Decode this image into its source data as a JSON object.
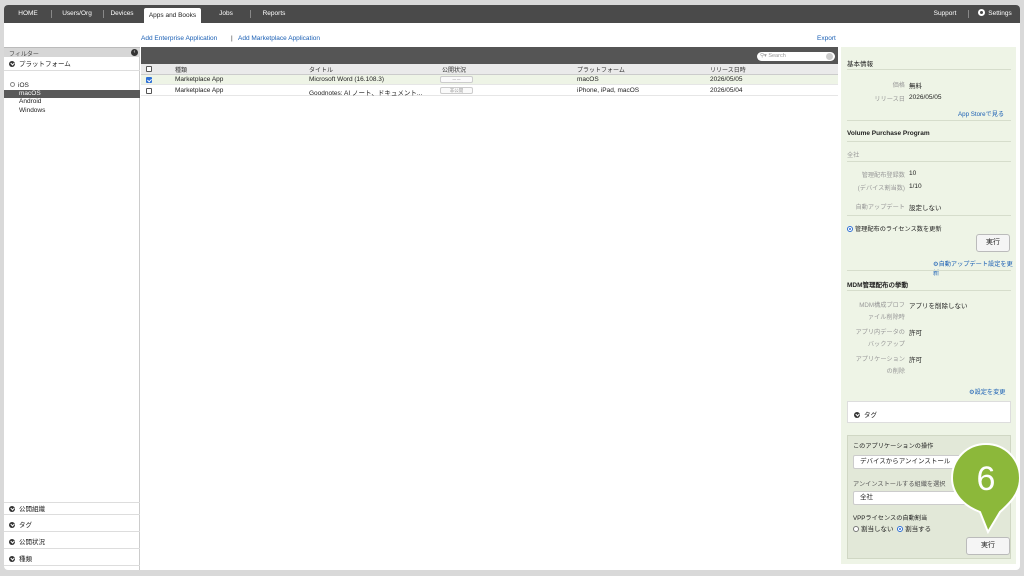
{
  "nav": {
    "items": [
      "HOME",
      "Users/Org",
      "Devices",
      "Apps and Books",
      "Jobs",
      "Reports"
    ],
    "active": "Apps and Books",
    "support": "Support",
    "settings": "Settings"
  },
  "links": {
    "add_enterprise": "Add Enterprise Application",
    "separator": "|",
    "add_marketplace": "Add Marketplace Application",
    "export": "Export"
  },
  "filter": {
    "title": "フィルター",
    "platform_section": "プラットフォーム",
    "platforms": [
      "iOS",
      "macOS",
      "Android",
      "Windows"
    ],
    "selected_platform": "macOS",
    "bottom_sections": [
      "公開組織",
      "タグ",
      "公開状況",
      "種類"
    ]
  },
  "table": {
    "search_placeholder": "Search",
    "headers": [
      "種類",
      "タイトル",
      "公開状況",
      "プラットフォーム",
      "リリース日時"
    ],
    "rows": [
      {
        "checked": true,
        "type": "Marketplace App",
        "title": "Microsoft Word (16.108.3)",
        "status": "ーー",
        "platform": "macOS",
        "release": "2026/05/05"
      },
      {
        "checked": false,
        "type": "Marketplace App",
        "title": "Goodnotes: AI ノート、ドキュメント...",
        "status": "非公開",
        "platform": "iPhone, iPad, macOS",
        "release": "2026/05/04"
      }
    ]
  },
  "detail": {
    "basic_info": "基本情報",
    "price_label": "価格",
    "price_value": "無料",
    "release_label": "リリース日",
    "release_value": "2026/05/05",
    "app_store_link": "App Storeで見る",
    "vpp_title": "Volume Purchase Program",
    "vpp_scope": "全社",
    "managed_count_label": "管理配布登録数",
    "managed_count_value": "10",
    "device_assigned_label": "(デバイス割当数)",
    "device_assigned_value": "1/10",
    "auto_update_label": "自動アップデート",
    "auto_update_value": "設定しない",
    "update_license_option": "管理配布のライセンス数を更新",
    "run_label": "実行",
    "auto_update_link": "自動アップデート設定を更新",
    "mdm_title": "MDM管理配布の挙動",
    "mdm_profile_label_1": "MDM構成プロフ",
    "mdm_profile_label_2": "ァイル削除時",
    "mdm_profile_value": "アプリを削除しない",
    "backup_label_1": "アプリ内データの",
    "backup_label_2": "バックアップ",
    "backup_value": "許可",
    "delete_label_1": "アプリケーション",
    "delete_label_2": "の削除",
    "delete_value": "許可",
    "change_settings_link": "設定を変更",
    "tag_section": "タグ",
    "ops_title": "このアプリケーションの操作",
    "ops_select": "デバイスからアンインストール",
    "uninstall_org_label": "アンインストールする組織を選択",
    "org_select": "全社",
    "vpp_auto_label": "VPPライセンスの自動割当",
    "radio_off": "割当しない",
    "radio_on": "割当する",
    "run_bottom": "実行"
  },
  "callout": {
    "number": "6",
    "color": "#8cb83a"
  }
}
